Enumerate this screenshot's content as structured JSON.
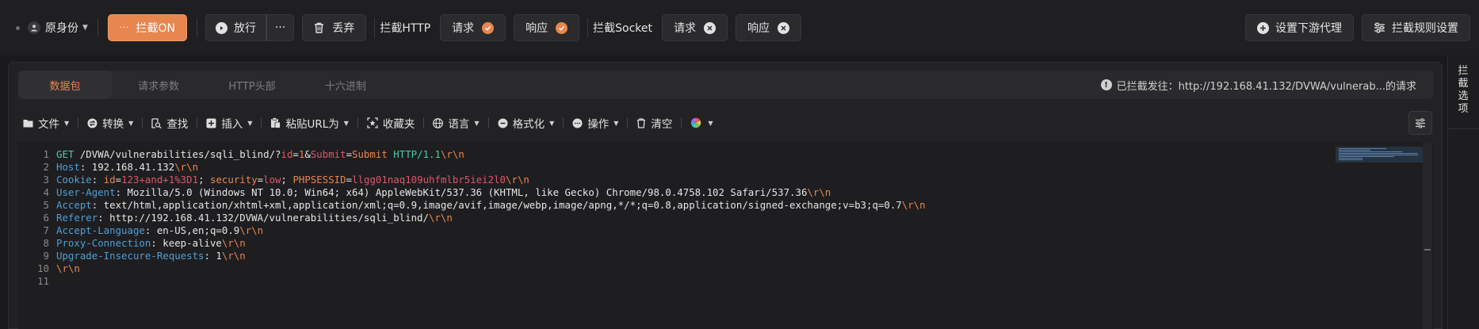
{
  "topbar": {
    "identity_label": "原身份",
    "intercept_label": "拦截ON",
    "release_label": "放行",
    "more_label": "···",
    "drop_label": "丢弃",
    "http_label": "拦截HTTP",
    "http_request_label": "请求",
    "http_response_label": "响应",
    "socket_label": "拦截Socket",
    "socket_request_label": "请求",
    "socket_response_label": "响应",
    "downstream_proxy_label": "设置下游代理",
    "rules_label": "拦截规则设置",
    "accent_color": "#e8864f"
  },
  "tabs": [
    {
      "label": "数据包",
      "active": true
    },
    {
      "label": "请求参数",
      "active": false
    },
    {
      "label": "HTTP头部",
      "active": false
    },
    {
      "label": "十六进制",
      "active": false
    }
  ],
  "info": {
    "text": "已拦截发往：http://192.168.41.132/DVWA/vulnerab...的请求"
  },
  "toolbar": {
    "file": "文件",
    "convert": "转换",
    "find": "查找",
    "insert": "插入",
    "paste_url": "粘贴URL为",
    "favorites": "收藏夹",
    "language": "语言",
    "format": "格式化",
    "operate": "操作",
    "clear": "清空"
  },
  "editor": {
    "lines": [
      {
        "n": "1",
        "tokens": [
          [
            "GET",
            "k-green"
          ],
          [
            " /DVWA/vulnerabilities/sqli_blind/?",
            ""
          ],
          [
            "id",
            "k-red"
          ],
          [
            "=",
            ""
          ],
          [
            "1",
            "k-orange"
          ],
          [
            "&",
            ""
          ],
          [
            "Submit",
            "k-red"
          ],
          [
            "=",
            ""
          ],
          [
            "Submit",
            "k-orange"
          ],
          [
            " ",
            ""
          ],
          [
            "HTTP/1.1",
            "k-green"
          ],
          [
            "\\r\\n",
            "k-orange"
          ]
        ]
      },
      {
        "n": "2",
        "tokens": [
          [
            "Host",
            "k-blue"
          ],
          [
            ": 192.168.41.132",
            ""
          ],
          [
            "\\r\\n",
            "k-orange"
          ]
        ]
      },
      {
        "n": "3",
        "tokens": [
          [
            "Cookie",
            "k-blue"
          ],
          [
            ": ",
            ""
          ],
          [
            "id",
            "k-orange"
          ],
          [
            "=",
            ""
          ],
          [
            "123+and+1%3D1",
            "k-red"
          ],
          [
            "; ",
            ""
          ],
          [
            "security",
            "k-orange"
          ],
          [
            "=",
            ""
          ],
          [
            "low",
            "k-red"
          ],
          [
            "; ",
            ""
          ],
          [
            "PHPSESSID",
            "k-orange"
          ],
          [
            "=",
            ""
          ],
          [
            "llgg01naq109uhfmlbr5iei2l0",
            "k-red"
          ],
          [
            "\\r\\n",
            "k-orange"
          ]
        ]
      },
      {
        "n": "4",
        "tokens": [
          [
            "User-Agent",
            "k-blue"
          ],
          [
            ": Mozilla/5.0 (Windows NT 10.0; Win64; x64) AppleWebKit/537.36 (KHTML, like Gecko) Chrome/98.0.4758.102 Safari/537.36",
            ""
          ],
          [
            "\\r\\n",
            "k-orange"
          ]
        ]
      },
      {
        "n": "5",
        "tokens": [
          [
            "Accept",
            "k-blue"
          ],
          [
            ": text/html,application/xhtml+xml,application/xml;q=0.9,image/avif,image/webp,image/apng,*/*;q=0.8,application/signed-exchange;v=b3;q=0.7",
            ""
          ],
          [
            "\\r\\n",
            "k-orange"
          ]
        ]
      },
      {
        "n": "6",
        "tokens": [
          [
            "Referer",
            "k-blue"
          ],
          [
            ": http://192.168.41.132/DVWA/vulnerabilities/sqli_blind/",
            ""
          ],
          [
            "\\r\\n",
            "k-orange"
          ]
        ]
      },
      {
        "n": "7",
        "tokens": [
          [
            "Accept-Language",
            "k-blue"
          ],
          [
            ": en-US,en;q=0.9",
            ""
          ],
          [
            "\\r\\n",
            "k-orange"
          ]
        ]
      },
      {
        "n": "8",
        "tokens": [
          [
            "Proxy-Connection",
            "k-blue"
          ],
          [
            ": keep-alive",
            ""
          ],
          [
            "\\r\\n",
            "k-orange"
          ]
        ]
      },
      {
        "n": "9",
        "tokens": [
          [
            "Upgrade-Insecure-Requests",
            "k-blue"
          ],
          [
            ": 1",
            ""
          ],
          [
            "\\r\\n",
            "k-orange"
          ]
        ]
      },
      {
        "n": "10",
        "tokens": [
          [
            "\\r\\n",
            "k-orange"
          ]
        ]
      },
      {
        "n": "11",
        "tokens": []
      }
    ]
  },
  "side": {
    "label": "拦截选项"
  }
}
